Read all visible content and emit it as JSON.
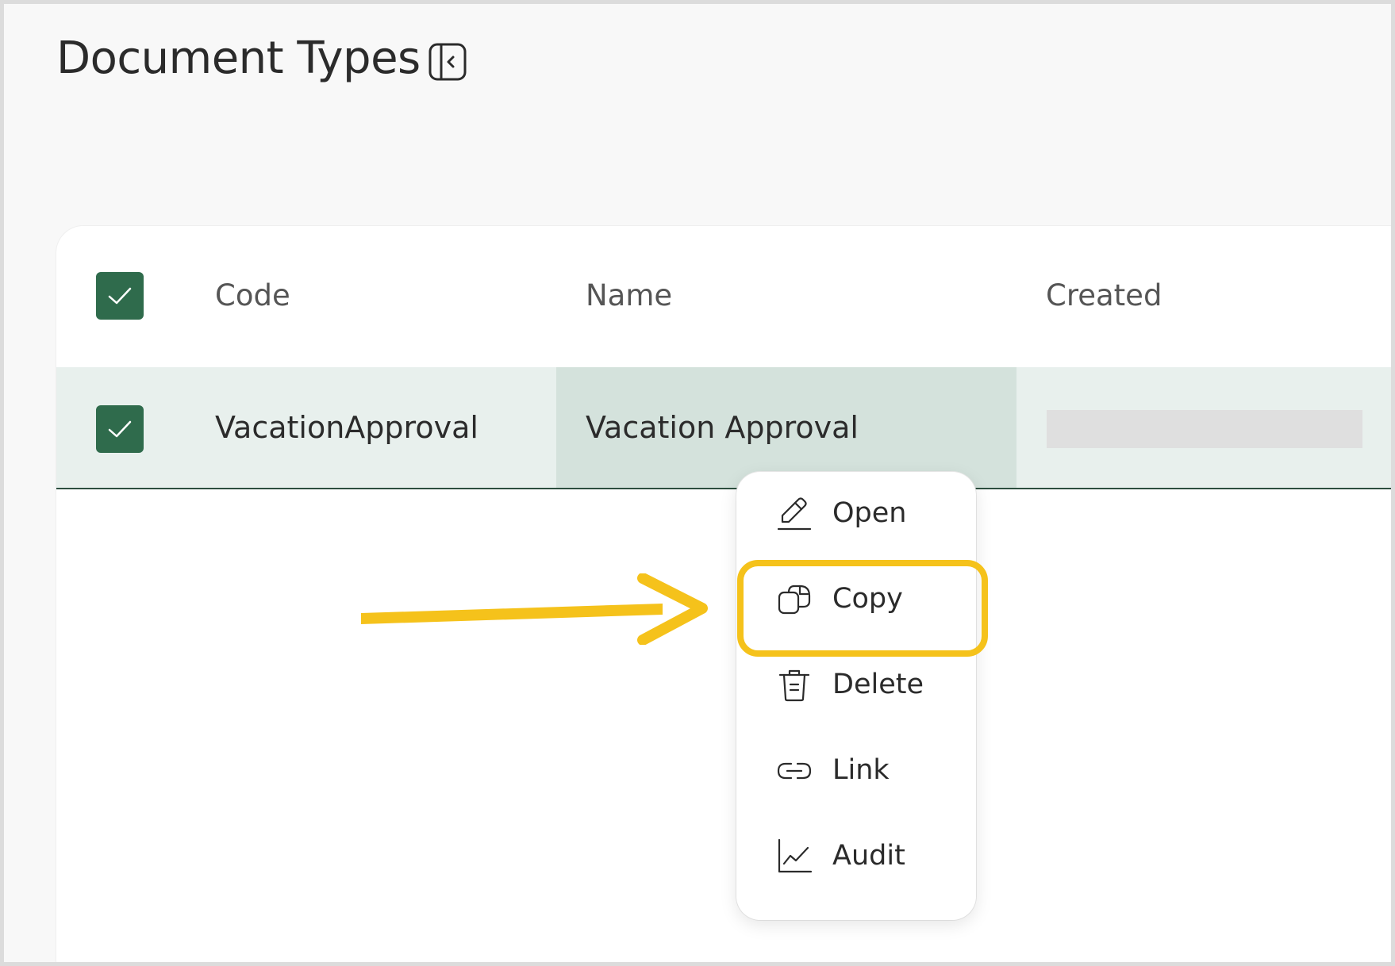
{
  "page": {
    "title": "Document Types",
    "collapse_icon": "sidebar-collapse-icon"
  },
  "table": {
    "columns": [
      "Code",
      "Name",
      "Created"
    ],
    "select_all_checked": true,
    "rows": [
      {
        "checked": true,
        "code": "VacationApproval",
        "name": "Vacation Approval",
        "created": ""
      }
    ]
  },
  "context_menu": {
    "items": [
      {
        "label": "Open",
        "icon": "edit-pencil-icon"
      },
      {
        "label": "Copy",
        "icon": "copy-icon",
        "highlighted": true
      },
      {
        "label": "Delete",
        "icon": "trash-icon"
      },
      {
        "label": "Link",
        "icon": "link-icon"
      },
      {
        "label": "Audit",
        "icon": "chart-line-icon"
      }
    ]
  },
  "colors": {
    "checkbox": "#2f6b4c",
    "selected_row": "#e8f0ed",
    "selected_cell": "#d4e2dc",
    "highlight": "#f5c21b"
  }
}
